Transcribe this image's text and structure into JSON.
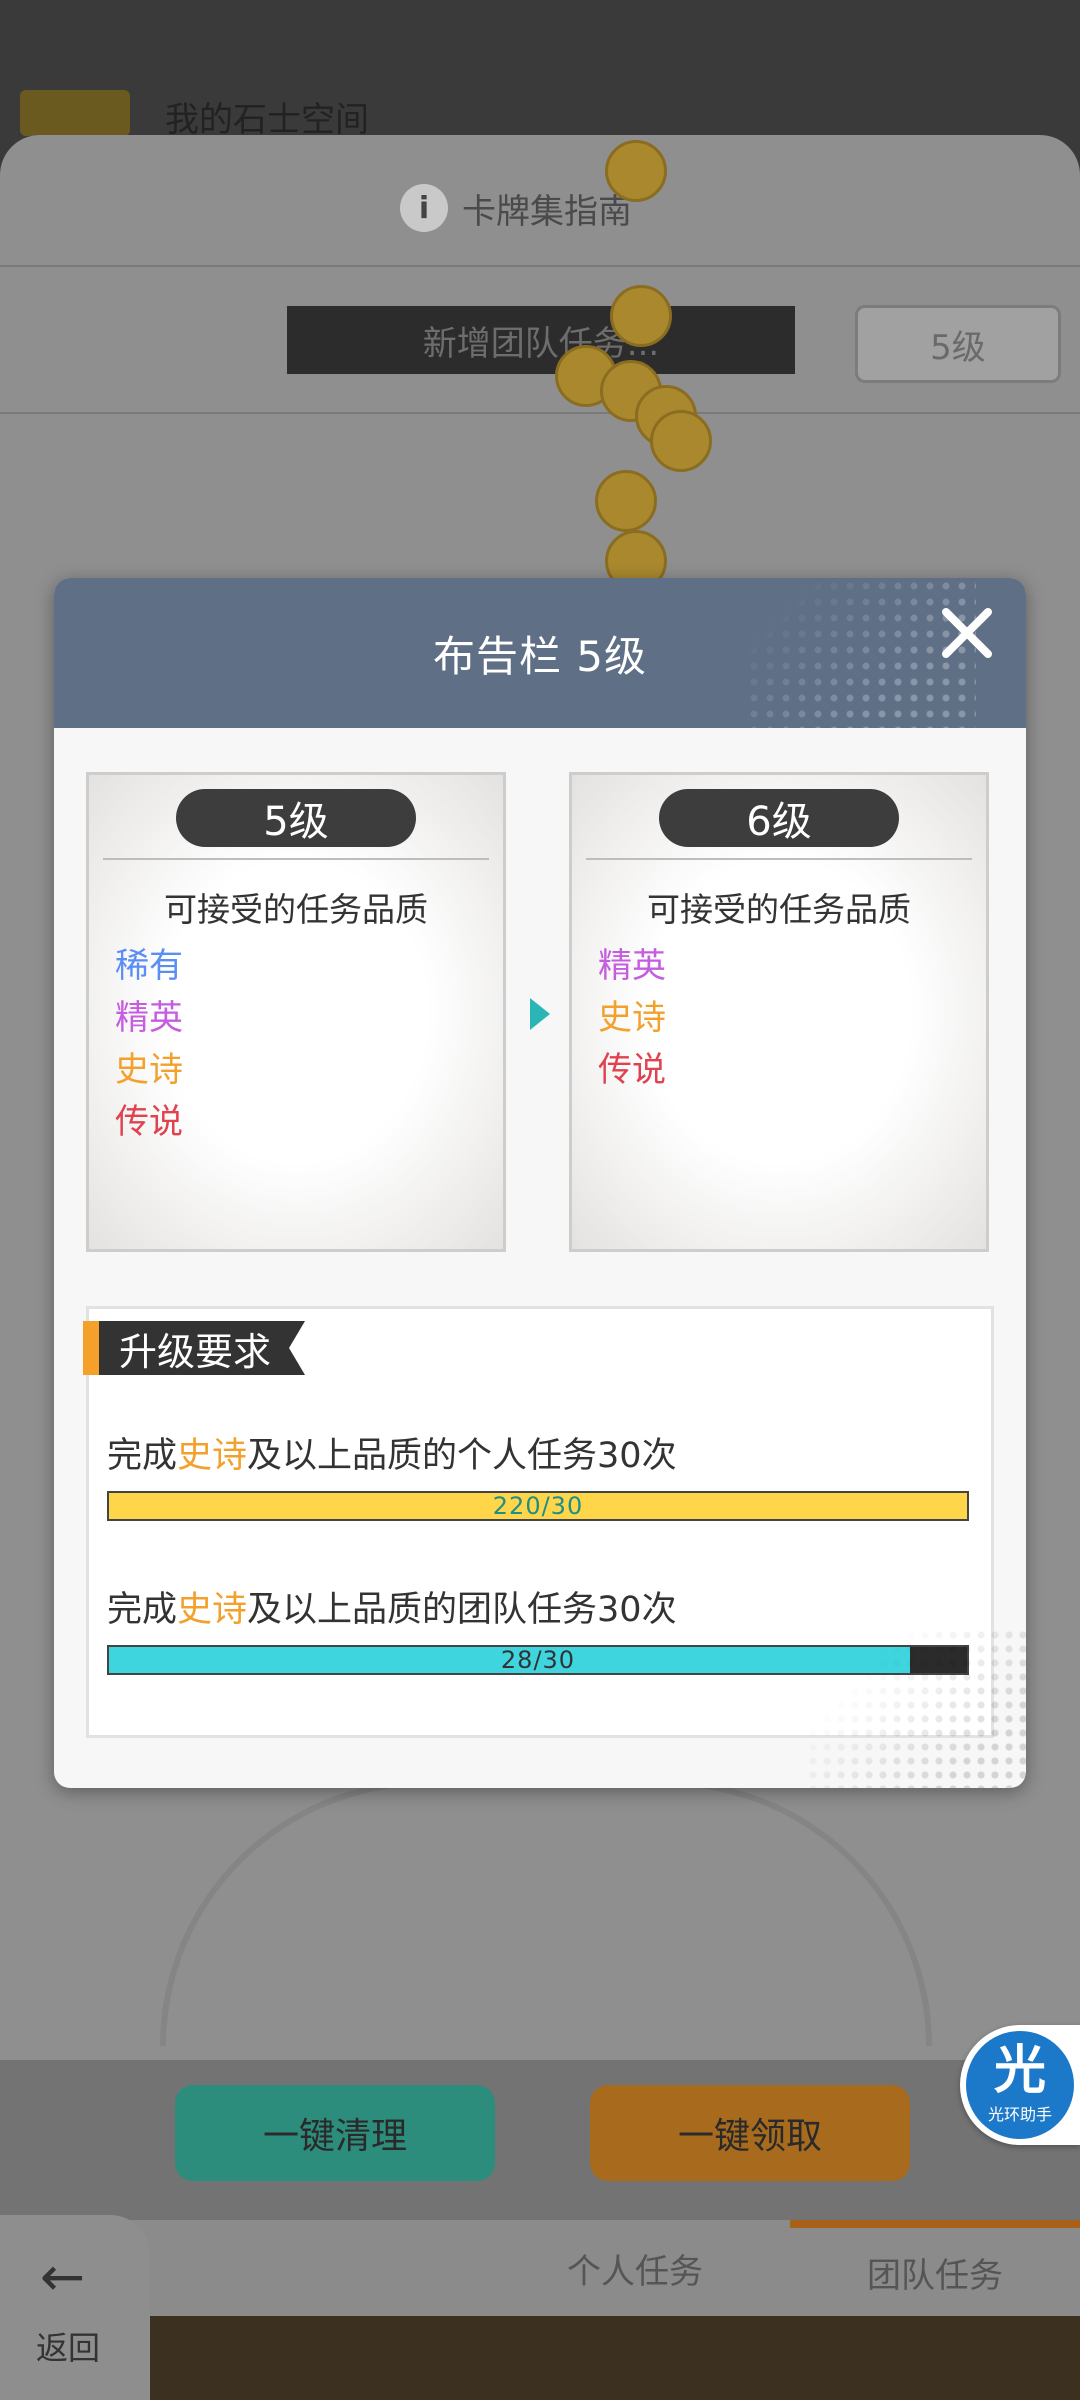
{
  "background": {
    "top_title": "我的石士空间",
    "guide": "卡牌集指南",
    "new_task": "新增团队任务...",
    "level_btn": "5级",
    "btn_left": "一键清理",
    "btn_right": "一键领取",
    "tab_personal": "个人任务",
    "tab_team": "团队任务",
    "back_label": "返回"
  },
  "modal": {
    "title": "布告栏 5级",
    "current": {
      "level": "5级",
      "subtitle": "可接受的任务品质",
      "qualities": [
        {
          "label": "稀有",
          "color": "#5b8ef5"
        },
        {
          "label": "精英",
          "color": "#c65de0"
        },
        {
          "label": "史诗",
          "color": "#f2a12c"
        },
        {
          "label": "传说",
          "color": "#e0424f"
        }
      ]
    },
    "next": {
      "level": "6级",
      "subtitle": "可接受的任务品质",
      "qualities": [
        {
          "label": "精英",
          "color": "#c65de0"
        },
        {
          "label": "史诗",
          "color": "#f2a12c"
        },
        {
          "label": "传说",
          "color": "#e0424f"
        }
      ]
    },
    "requirements": {
      "header": "升级要求",
      "items": [
        {
          "prefix": "完成",
          "highlight": "史诗",
          "suffix": "及以上品质的个人任务30次",
          "progress_text": "220/30",
          "progress": 1.0,
          "bar_color": "#ffd54a"
        },
        {
          "prefix": "完成",
          "highlight": "史诗",
          "suffix": "及以上品质的团队任务30次",
          "progress_text": "28/30",
          "progress": 0.933,
          "bar_color": "#3fd5de"
        }
      ]
    }
  },
  "assistant": {
    "glyph": "光",
    "label": "光环助手"
  }
}
